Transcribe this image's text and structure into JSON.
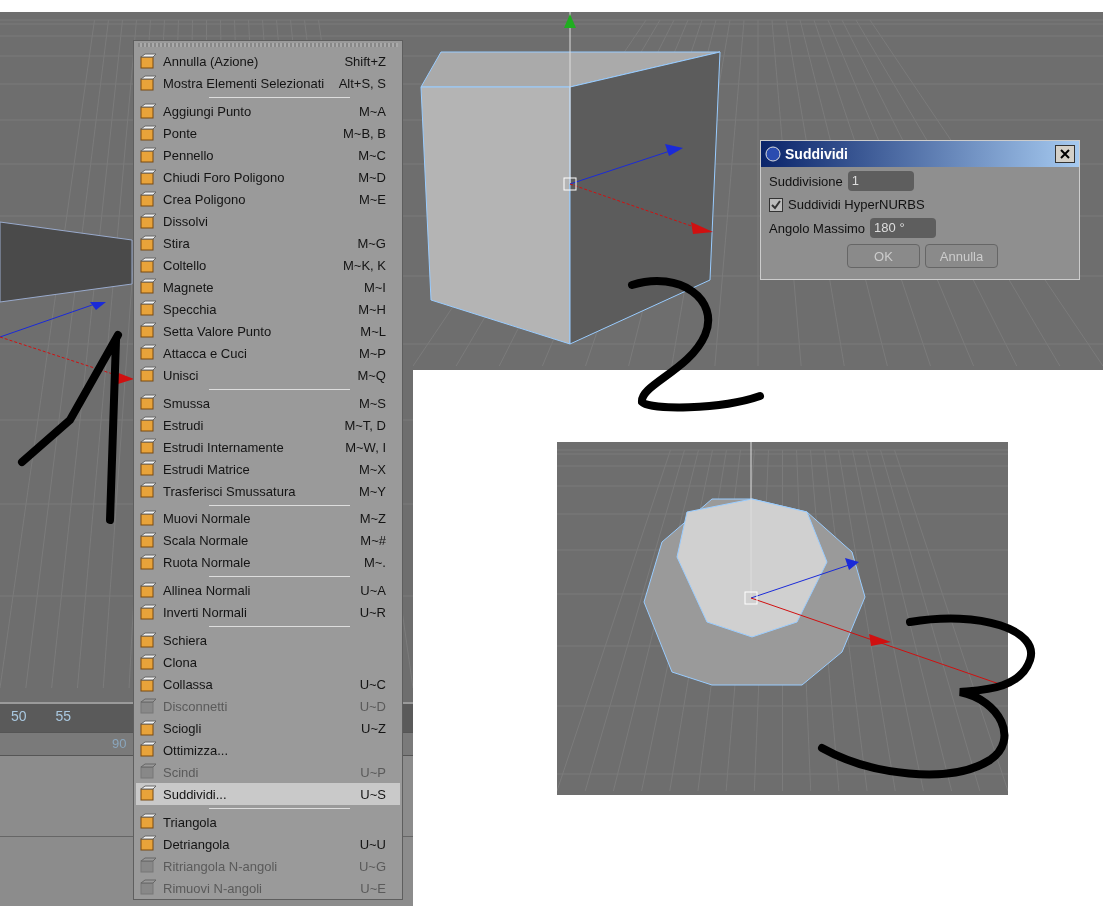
{
  "timeline": {
    "ticks": [
      "50",
      "55"
    ],
    "frame_field": "90"
  },
  "menu": {
    "items": [
      {
        "kind": "item",
        "label": "Annulla (Azione)",
        "shortcut": "Shift+Z",
        "disabled": false,
        "selected": false
      },
      {
        "kind": "item",
        "label": "Mostra Elementi Selezionati",
        "shortcut": "Alt+S, S",
        "disabled": false,
        "selected": false
      },
      {
        "kind": "separator"
      },
      {
        "kind": "item",
        "label": "Aggiungi Punto",
        "shortcut": "M~A",
        "disabled": false,
        "selected": false
      },
      {
        "kind": "item",
        "label": "Ponte",
        "shortcut": "M~B, B",
        "disabled": false,
        "selected": false
      },
      {
        "kind": "item",
        "label": "Pennello",
        "shortcut": "M~C",
        "disabled": false,
        "selected": false
      },
      {
        "kind": "item",
        "label": "Chiudi Foro Poligono",
        "shortcut": "M~D",
        "disabled": false,
        "selected": false
      },
      {
        "kind": "item",
        "label": "Crea Poligono",
        "shortcut": "M~E",
        "disabled": false,
        "selected": false
      },
      {
        "kind": "item",
        "label": "Dissolvi",
        "disabled": false,
        "selected": false
      },
      {
        "kind": "item",
        "label": "Stira",
        "shortcut": "M~G",
        "disabled": false,
        "selected": false
      },
      {
        "kind": "item",
        "label": "Coltello",
        "shortcut": "M~K, K",
        "disabled": false,
        "selected": false
      },
      {
        "kind": "item",
        "label": "Magnete",
        "shortcut": "M~I",
        "disabled": false,
        "selected": false
      },
      {
        "kind": "item",
        "label": "Specchia",
        "shortcut": "M~H",
        "disabled": false,
        "selected": false
      },
      {
        "kind": "item",
        "label": "Setta Valore Punto",
        "shortcut": "M~L",
        "disabled": false,
        "selected": false
      },
      {
        "kind": "item",
        "label": "Attacca e Cuci",
        "shortcut": "M~P",
        "disabled": false,
        "selected": false
      },
      {
        "kind": "item",
        "label": "Unisci",
        "shortcut": "M~Q",
        "disabled": false,
        "selected": false
      },
      {
        "kind": "separator"
      },
      {
        "kind": "item",
        "label": "Smussa",
        "shortcut": "M~S",
        "disabled": false,
        "selected": false
      },
      {
        "kind": "item",
        "label": "Estrudi",
        "shortcut": "M~T, D",
        "disabled": false,
        "selected": false
      },
      {
        "kind": "item",
        "label": "Estrudi Internamente",
        "shortcut": "M~W, I",
        "disabled": false,
        "selected": false
      },
      {
        "kind": "item",
        "label": "Estrudi Matrice",
        "shortcut": "M~X",
        "disabled": false,
        "selected": false
      },
      {
        "kind": "item",
        "label": "Trasferisci Smussatura",
        "shortcut": "M~Y",
        "disabled": false,
        "selected": false
      },
      {
        "kind": "separator"
      },
      {
        "kind": "item",
        "label": "Muovi Normale",
        "shortcut": "M~Z",
        "disabled": false,
        "selected": false
      },
      {
        "kind": "item",
        "label": "Scala Normale",
        "shortcut": "M~#",
        "disabled": false,
        "selected": false
      },
      {
        "kind": "item",
        "label": "Ruota Normale",
        "shortcut": "M~.",
        "disabled": false,
        "selected": false
      },
      {
        "kind": "separator"
      },
      {
        "kind": "item",
        "label": "Allinea Normali",
        "shortcut": "U~A",
        "disabled": false,
        "selected": false
      },
      {
        "kind": "item",
        "label": "Inverti Normali",
        "shortcut": "U~R",
        "disabled": false,
        "selected": false
      },
      {
        "kind": "separator"
      },
      {
        "kind": "item",
        "label": "Schiera",
        "disabled": false,
        "selected": false
      },
      {
        "kind": "item",
        "label": "Clona",
        "disabled": false,
        "selected": false
      },
      {
        "kind": "item",
        "label": "Collassa",
        "shortcut": "U~C",
        "disabled": false,
        "selected": false
      },
      {
        "kind": "item",
        "label": "Disconnetti",
        "shortcut": "U~D",
        "disabled": true,
        "selected": false
      },
      {
        "kind": "item",
        "label": "Sciogli",
        "shortcut": "U~Z",
        "disabled": false,
        "selected": false
      },
      {
        "kind": "item",
        "label": "Ottimizza...",
        "disabled": false,
        "selected": false
      },
      {
        "kind": "item",
        "label": "Scindi",
        "shortcut": "U~P",
        "disabled": true,
        "selected": false
      },
      {
        "kind": "item",
        "label": "Suddividi...",
        "shortcut": "U~S",
        "disabled": false,
        "selected": true
      },
      {
        "kind": "separator"
      },
      {
        "kind": "item",
        "label": "Triangola",
        "disabled": false,
        "selected": false
      },
      {
        "kind": "item",
        "label": "Detriangola",
        "shortcut": "U~U",
        "disabled": false,
        "selected": false
      },
      {
        "kind": "item",
        "label": "Ritriangola N-angoli",
        "shortcut": "U~G",
        "disabled": true,
        "selected": false
      },
      {
        "kind": "item",
        "label": "Rimuovi N-angoli",
        "shortcut": "U~E",
        "disabled": true,
        "selected": false
      }
    ]
  },
  "dialog": {
    "title": "Suddividi",
    "fields": [
      {
        "kind": "number",
        "label": "Suddivisione",
        "value": "1"
      },
      {
        "kind": "checkbox",
        "label": "Suddividi HyperNURBS",
        "checked": true
      },
      {
        "kind": "number",
        "label": "Angolo Massimo",
        "value": "180 °"
      }
    ],
    "buttons": [
      "OK",
      "Annulla"
    ]
  }
}
